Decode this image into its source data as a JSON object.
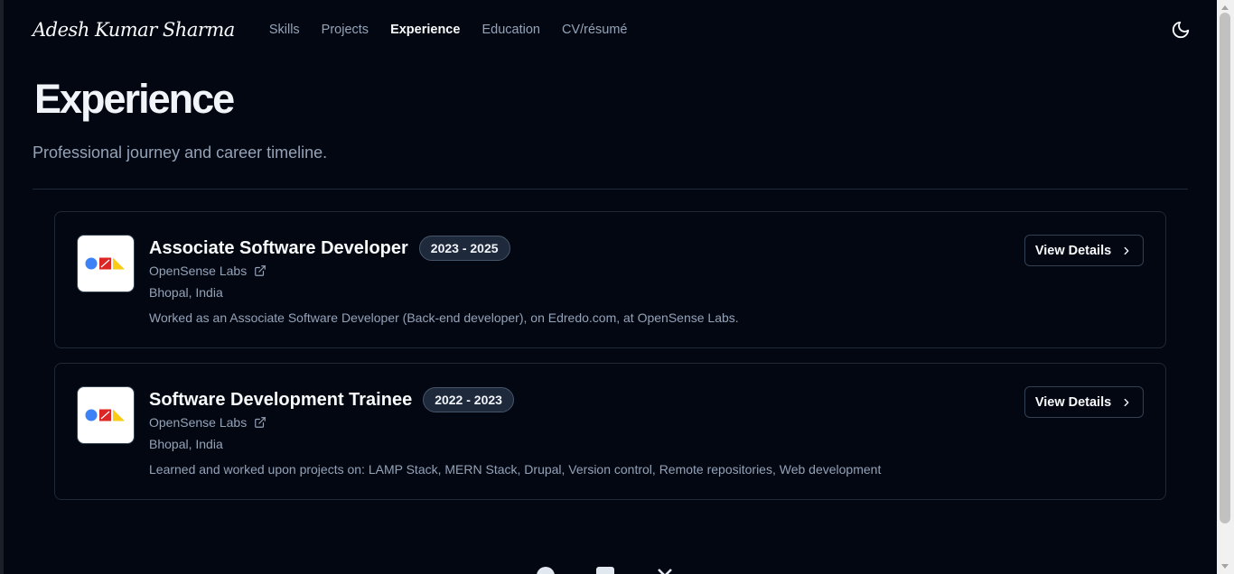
{
  "header": {
    "logo": "Adesh Kumar Sharma",
    "nav": [
      {
        "label": "Skills",
        "active": false
      },
      {
        "label": "Projects",
        "active": false
      },
      {
        "label": "Experience",
        "active": true
      },
      {
        "label": "Education",
        "active": false
      },
      {
        "label": "CV/résumé",
        "active": false
      }
    ],
    "theme_toggle_icon": "moon-icon"
  },
  "page": {
    "title": "Experience",
    "subtitle": "Professional journey and career timeline."
  },
  "experiences": [
    {
      "title": "Associate Software Developer",
      "dates": "2023 - 2025",
      "company": "OpenSense Labs",
      "location": "Bhopal, India",
      "description": "Worked as an Associate Software Developer (Back-end developer), on Edredo.com, at OpenSense Labs.",
      "button": "View Details"
    },
    {
      "title": "Software Development Trainee",
      "dates": "2022 - 2023",
      "company": "OpenSense Labs",
      "location": "Bhopal, India",
      "description": "Learned and worked upon projects on: LAMP Stack, MERN Stack, Drupal, Version control, Remote repositories, Web development",
      "button": "View Details"
    }
  ],
  "colors": {
    "background": "#030712",
    "text": "#f8fafc",
    "muted": "#94a3b8",
    "border": "#1f2937",
    "logo_blue": "#3b82f6",
    "logo_red": "#dc2626",
    "logo_yellow": "#facc15"
  },
  "footer": {
    "icons": [
      "github-icon",
      "linkedin-icon",
      "x-icon"
    ]
  }
}
